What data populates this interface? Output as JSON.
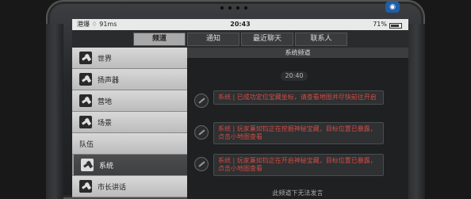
{
  "status_bar": {
    "carrier": "港爆 ♢ 91ms",
    "time": "20:43",
    "battery": "71%"
  },
  "top_button": "◉",
  "tabs": [
    {
      "label": "频道",
      "active": true
    },
    {
      "label": "通知",
      "active": false
    },
    {
      "label": "最近聊天",
      "active": false
    },
    {
      "label": "联系人",
      "active": false
    }
  ],
  "sidebar": {
    "items": [
      {
        "label": "世界",
        "active": false
      },
      {
        "label": "扬声器",
        "active": false
      },
      {
        "label": "营地",
        "active": false
      },
      {
        "label": "场景",
        "active": false
      },
      {
        "label": "队伍",
        "active": false
      },
      {
        "label": "系统",
        "active": true
      },
      {
        "label": "市长讲话",
        "active": false
      }
    ]
  },
  "channel": {
    "title": "系统频道",
    "time_divider": "20:40",
    "messages": [
      {
        "text": "系统 | 已成功定位宝藏坐标，请查看地图并尽快前往开启"
      },
      {
        "text": "系统 | 玩家蒹如钧正在挖掘神秘宝藏，目标位置已暴露，点击小地图查看"
      },
      {
        "text": "系统 | 玩家蒹如钧正在开启神秘宝藏，目标位置已暴露，点击小地图查看"
      }
    ],
    "footer": "此频道下无法发言"
  },
  "colors": {
    "system_text": "#d24b43",
    "active_tab": "#a9a9a9"
  }
}
